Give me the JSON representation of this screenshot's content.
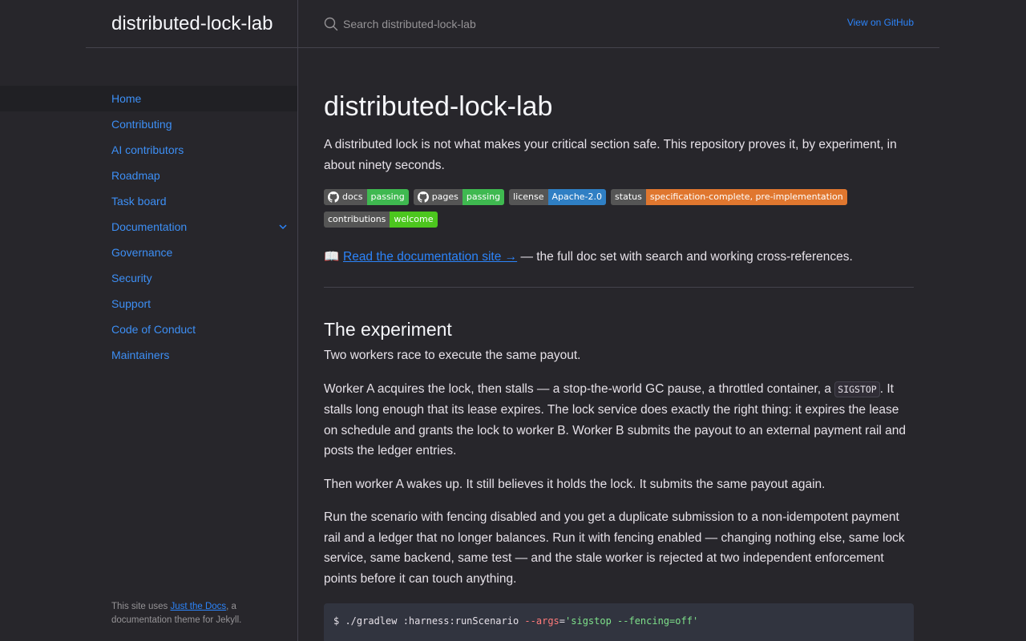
{
  "site": {
    "title": "distributed-lock-lab"
  },
  "search": {
    "placeholder": "Search distributed-lock-lab"
  },
  "header": {
    "github_link": "View on GitHub"
  },
  "nav": {
    "items": [
      {
        "label": "Home",
        "active": true
      },
      {
        "label": "Contributing"
      },
      {
        "label": "AI contributors"
      },
      {
        "label": "Roadmap"
      },
      {
        "label": "Task board"
      },
      {
        "label": "Documentation",
        "expandable": true
      },
      {
        "label": "Governance"
      },
      {
        "label": "Security"
      },
      {
        "label": "Support"
      },
      {
        "label": "Code of Conduct"
      },
      {
        "label": "Maintainers"
      }
    ]
  },
  "footer": {
    "prefix": "This site uses ",
    "link": "Just the Docs",
    "suffix": ", a documentation theme for Jekyll."
  },
  "main": {
    "title": "distributed-lock-lab",
    "lead": "A distributed lock is not what makes your critical section safe. This repository proves it, by experiment, in about ninety seconds.",
    "badges": [
      {
        "label": "docs",
        "value": "passing",
        "color": "#3fb950",
        "icon": "github-icon"
      },
      {
        "label": "pages",
        "value": "passing",
        "color": "#3fb950",
        "icon": "github-icon"
      },
      {
        "label": "license",
        "value": "Apache-2.0",
        "color": "#2f7fc4"
      },
      {
        "label": "status",
        "value": "specification-complete, pre-implementation",
        "color": "#e0772f"
      },
      {
        "label": "contributions",
        "value": "welcome",
        "color": "#4cc61e"
      }
    ],
    "doc_link": {
      "icon": "book-icon",
      "link": "Read the documentation site →",
      "rest": " — the full doc set with search and working cross-references."
    },
    "section_title": "The experiment",
    "p1": "Two workers race to execute the same payout.",
    "p2_before": "Worker A acquires the lock, then stalls — a stop-the-world GC pause, a throttled container, a ",
    "p2_code": "SIGSTOP",
    "p2_after": ". It stalls long enough that its lease expires. The lock service does exactly the right thing: it expires the lease on schedule and grants the lock to worker B. Worker B submits the payout to an external payment rail and posts the ledger entries.",
    "p3": "Then worker A wakes up. It still believes it holds the lock. It submits the same payout again.",
    "p4": "Run the scenario with fencing disabled and you get a duplicate submission to a non-idempotent payment rail and a ledger that no longer balances. Run it with fencing enabled — changing nothing else, same lock service, same backend, same test — and the stale worker is rejected at two independent enforcement points before it can touch anything.",
    "code": {
      "cmd": "$ ./gradlew :harness:runScenario ",
      "flag": "--args",
      "eq": "=",
      "str": "'sigstop --fencing=off'"
    }
  },
  "colors": {
    "background": "#27262b",
    "link": "#2c84fa",
    "active_nav_bg": "#202024"
  }
}
